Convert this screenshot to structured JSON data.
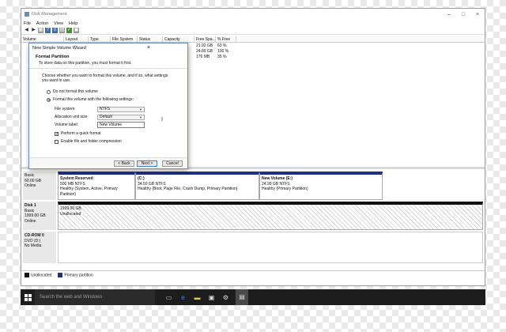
{
  "window": {
    "title": "Disk Management",
    "menu": [
      "File",
      "Action",
      "View",
      "Help"
    ]
  },
  "toolbar": [
    "back-arrow",
    "forward-arrow",
    "grid-view",
    "help",
    "list",
    "properties",
    "refresh",
    "settings"
  ],
  "volume_table": {
    "columns": [
      "Volume",
      "Layout",
      "Type",
      "File System",
      "Status",
      "Capacity",
      "Free Spa...",
      "% Free"
    ],
    "rows": [
      {
        "volume": "",
        "free": "21.92 GB",
        "pct": "63 %"
      },
      {
        "volume": "",
        "free": "24.89 GB",
        "pct": "100 %"
      },
      {
        "volume": "",
        "free": "176 MB",
        "pct": "35 %"
      }
    ]
  },
  "wizard": {
    "title": "New Simple Volume Wizard",
    "header": "Format Partition",
    "subheader": "To store data on this partition, you must format it first.",
    "question": "Choose whether you want to format this volume, and if so, what settings you want to use.",
    "radio_no_format": "Do not format this volume",
    "radio_format": "Format this volume with the following settings:",
    "file_system_label": "File system:",
    "file_system_value": "NTFS",
    "alloc_label": "Allocation unit size:",
    "alloc_value": "Default",
    "volume_label_label": "Volume label:",
    "volume_label_value": "New Volume",
    "quick_format": "Perform a quick format",
    "compression": "Enable file and folder compression",
    "back": "< Back",
    "next": "Next >",
    "cancel": "Cancel"
  },
  "disks": {
    "disk0": {
      "line1": "Basic",
      "line2": "60.00 GB",
      "line3": "Online",
      "partitions": [
        {
          "name": "System Reserved",
          "size": "500 MB NTFS",
          "status": "Healthy (System, Active, Primary Partition)"
        },
        {
          "name": "(C:)",
          "size": "34.50 GB NTFS",
          "status": "Healthy (Boot, Page File, Crash Dump, Primary Partition)"
        },
        {
          "name": "New Volume  (E:)",
          "size": "24.99 GB NTFS",
          "status": "Healthy (Primary Partition)"
        }
      ]
    },
    "disk1": {
      "name": "Disk 1",
      "line1": "Basic",
      "line2": "1999.00 GB",
      "line3": "Online",
      "part_size": "1999.00 GB",
      "part_status": "Unallocated"
    },
    "cdrom": {
      "name": "CD-ROM 0",
      "line1": "DVD (D:)",
      "line2": "",
      "line3": "No Media"
    }
  },
  "legend": {
    "unallocated": "Unallocated",
    "primary": "Primary partition",
    "unallocated_color": "#111111",
    "primary_color": "#1e2f85"
  },
  "taskbar": {
    "search_placeholder": "Search the web and Windows",
    "icons": [
      "task-view-icon",
      "edge-icon",
      "file-explorer-icon",
      "store-icon",
      "settings-icon",
      "disk-management-icon"
    ]
  }
}
